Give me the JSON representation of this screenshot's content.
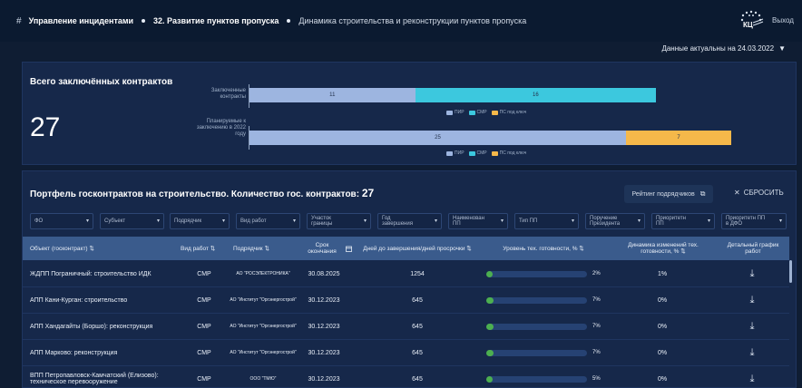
{
  "header": {
    "hash_icon": "#",
    "crumb1": "Управление инцидентами",
    "crumb2": "32. Развитие пунктов пропуска",
    "crumb3": "Динамика строительства и реконструкции пунктов пропуска",
    "logout": "Выход",
    "actual": "Данные актуальны на 24.03.2022",
    "actual_icon": "▼"
  },
  "summary": {
    "title": "Всего заключённых контрактов",
    "total": "27",
    "legend": [
      "ПИР",
      "СМР",
      "ПС под ключ"
    ]
  },
  "chart_data": {
    "type": "bar",
    "stacked": true,
    "orientation": "horizontal",
    "categories": [
      "Заключенные контракты",
      "Планируемые к заключению в 2022 году"
    ],
    "series": [
      {
        "name": "ПИР",
        "color": "#9db5e0",
        "values": [
          11,
          25
        ]
      },
      {
        "name": "СМР",
        "color": "#3cc8de",
        "values": [
          16,
          0
        ]
      },
      {
        "name": "ПС под ключ",
        "color": "#f5b84a",
        "values": [
          0,
          7
        ]
      }
    ],
    "xlim": [
      0,
      32
    ],
    "legend": "below each bar"
  },
  "portfolio": {
    "title": "Портфель госконтрактов на строительство. Количество гос. контрактов:",
    "count": "27",
    "rating": "Рейтинг подрядчиков",
    "rating_icon": "⧉",
    "reset": "СБРОСИТЬ",
    "reset_icon": "✕",
    "filters": [
      "ФО",
      "Субъект",
      "Подрядчик",
      "Вид работ",
      "Участок границы",
      "Год завершения",
      "Наименован ПП",
      "Тип ПП",
      "Поручение Президента",
      "Приоритетн ПП",
      "Приоритетн ПП в ДФО"
    ],
    "caret": "▾",
    "columns": [
      "Объект (госконтракт) ⇅",
      "Вид работ ⇅",
      "Подрядчик ⇅",
      "Срок окончания",
      "Дней до завершения/дней просрочки ⇅",
      "Уровень тех. готовности, % ⇅",
      "Динамика изменений тех. готовности, % ⇅",
      "Детальный график работ"
    ],
    "rows": [
      {
        "object": "ЖДПП Пограничный: строительство ИДК",
        "type": "СМР",
        "contractor": "АО \"РОСЭЛЕКТРОНИКА\"",
        "deadline": "30.08.2025",
        "days": "1254",
        "readiness": 2,
        "readiness_label": "2%",
        "dynamics": "1%",
        "download": "⤓"
      },
      {
        "object": "АПП Кани-Курган: строительство",
        "type": "СМР",
        "contractor": "АО \"Институт \"Оргэнергострой\"",
        "deadline": "30.12.2023",
        "days": "645",
        "readiness": 7,
        "readiness_label": "7%",
        "dynamics": "0%",
        "download": "⤓"
      },
      {
        "object": "АПП Хандагайты (Боршо): реконструкция",
        "type": "СМР",
        "contractor": "АО \"Институт \"Оргэнергострой\"",
        "deadline": "30.12.2023",
        "days": "645",
        "readiness": 7,
        "readiness_label": "7%",
        "dynamics": "0%",
        "download": "⤓"
      },
      {
        "object": "АПП Марково: реконструкция",
        "type": "СМР",
        "contractor": "АО \"Институт \"Оргэнергострой\"",
        "deadline": "30.12.2023",
        "days": "645",
        "readiness": 7,
        "readiness_label": "7%",
        "dynamics": "0%",
        "download": "⤓"
      },
      {
        "object": "ВПП Петропавловск-Камчатский (Елизово): техническое перевооружение",
        "type": "СМР",
        "contractor": "ООО \"ТМЮ\"",
        "deadline": "30.12.2023",
        "days": "645",
        "readiness": 5,
        "readiness_label": "5%",
        "dynamics": "0%",
        "download": "⤓"
      }
    ]
  }
}
